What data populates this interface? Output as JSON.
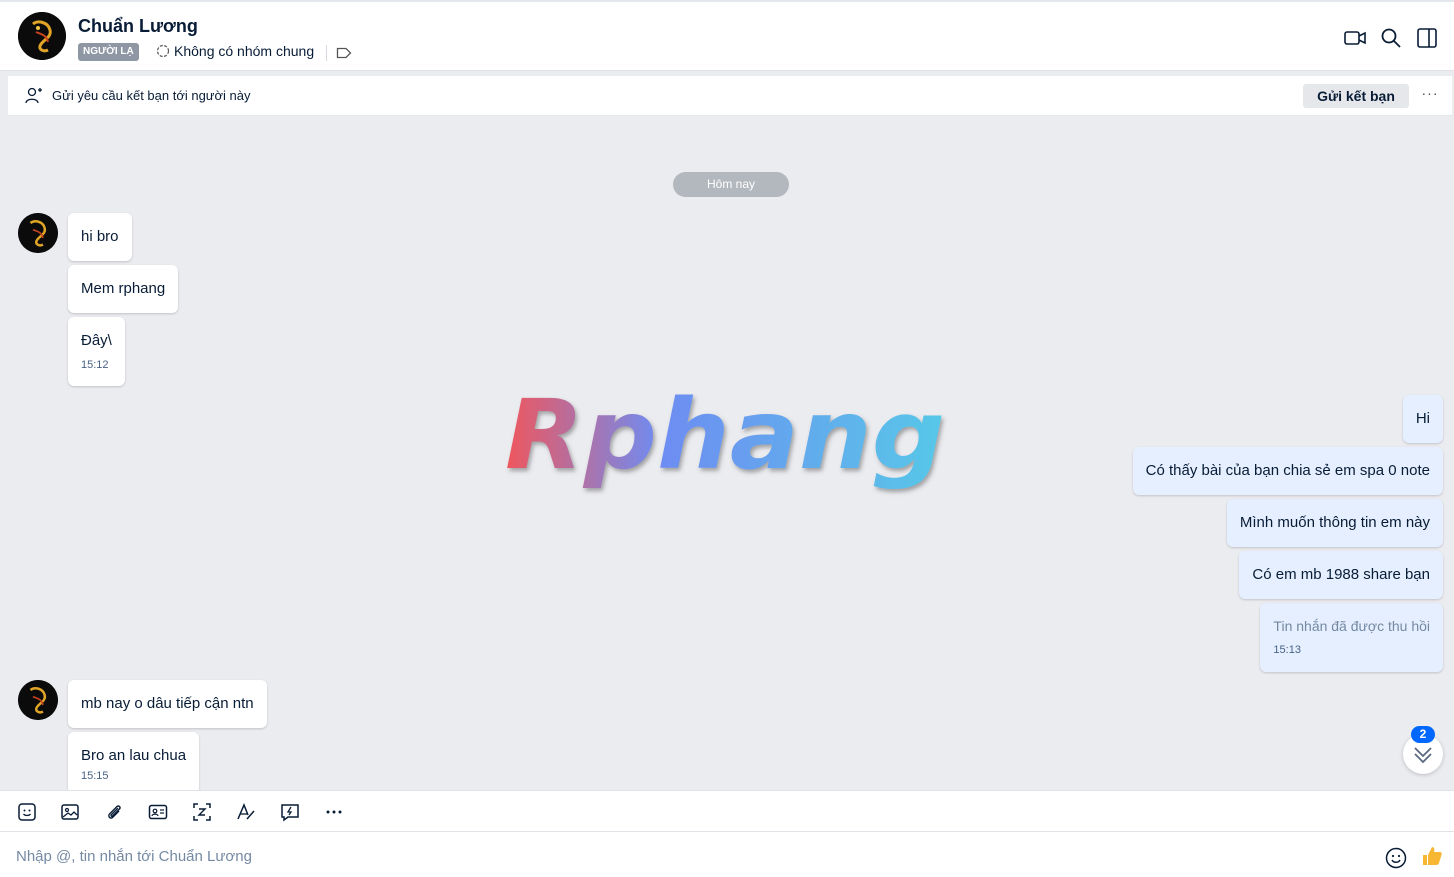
{
  "header": {
    "contact_name": "Chuẩn Lương",
    "badge": "NGƯỜI LẠ",
    "mutual_groups": "Không có nhóm chung",
    "icons": [
      "video-call-icon",
      "search-icon",
      "sidebar-toggle-icon"
    ]
  },
  "friend_bar": {
    "text": "Gửi yêu cầu kết bạn tới người này",
    "button_label": "Gửi kết bạn",
    "more_label": "···"
  },
  "date_separator": "Hôm nay",
  "watermark": "Rphang",
  "messages_in_1": [
    {
      "text": "hi bro"
    },
    {
      "text": "Mem rphang"
    },
    {
      "text": "Đây\\",
      "time": "15:12"
    }
  ],
  "messages_out": [
    {
      "text": "Hi"
    },
    {
      "text": "Có thấy bài của bạn chia sẻ em spa 0 note"
    },
    {
      "text": "Mình muốn thông tin em này"
    },
    {
      "text": "Có em mb 1988 share bạn"
    },
    {
      "text": "Tin nhắn đã được thu hồi",
      "time": "15:13",
      "recalled": true
    }
  ],
  "messages_in_2": [
    {
      "text": "mb nay o dâu tiếp cận ntn"
    },
    {
      "text": "Bro an lau chua",
      "time": "15:15"
    }
  ],
  "unread_count": "2",
  "toolbar": {
    "tools": [
      "sticker-icon",
      "image-icon",
      "attachment-icon",
      "contact-card-icon",
      "screenshot-icon",
      "text-format-icon",
      "quick-message-icon",
      "more-icon"
    ]
  },
  "composer": {
    "placeholder": "Nhập @, tin nhắn tới Chuẩn Lương"
  },
  "colors": {
    "accent": "#0068ff",
    "bubble_out": "#e5efff",
    "bubble_in": "#ffffff",
    "background": "#ebecf0"
  }
}
